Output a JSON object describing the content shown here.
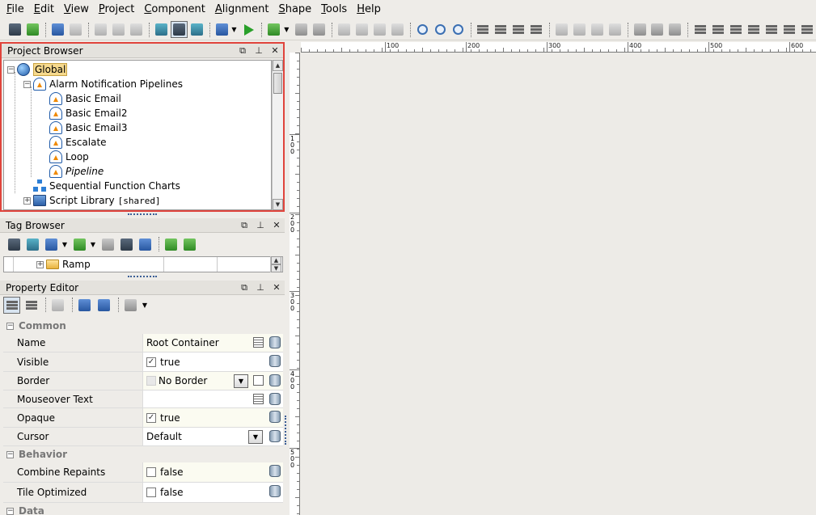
{
  "menu": [
    {
      "label": "File",
      "u": "F",
      "rest": "ile"
    },
    {
      "label": "Edit",
      "u": "E",
      "rest": "dit"
    },
    {
      "label": "View",
      "u": "V",
      "rest": "iew"
    },
    {
      "label": "Project",
      "u": "P",
      "rest": "roject"
    },
    {
      "label": "Component",
      "u": "C",
      "rest": "omponent"
    },
    {
      "label": "Alignment",
      "u": "A",
      "rest": "lignment"
    },
    {
      "label": "Shape",
      "u": "S",
      "rest": "hape"
    },
    {
      "label": "Tools",
      "u": "T",
      "rest": "ools"
    },
    {
      "label": "Help",
      "u": "H",
      "rest": "elp"
    }
  ],
  "project_browser": {
    "title": "Project Browser",
    "tree": [
      {
        "label": "Global",
        "icon": "globe-icon",
        "level": 0,
        "expander": "−",
        "selected": true
      },
      {
        "label": "Alarm Notification Pipelines",
        "icon": "alarm-pipeline-icon",
        "level": 1,
        "expander": "−"
      },
      {
        "label": "Basic Email",
        "icon": "alarm-pipeline-icon",
        "level": 2
      },
      {
        "label": "Basic Email2",
        "icon": "alarm-pipeline-icon",
        "level": 2
      },
      {
        "label": "Basic Email3",
        "icon": "alarm-pipeline-icon",
        "level": 2
      },
      {
        "label": "Escalate",
        "icon": "alarm-pipeline-icon",
        "level": 2
      },
      {
        "label": "Loop",
        "icon": "alarm-pipeline-icon",
        "level": 2
      },
      {
        "label": "Pipeline",
        "icon": "alarm-pipeline-icon",
        "level": 2,
        "italic": true
      },
      {
        "label": "Sequential Function Charts",
        "icon": "sfc-icon",
        "level": 1
      },
      {
        "label": "Script Library",
        "suffix": "[shared]",
        "icon": "script-library-icon",
        "level": 1,
        "expander": "+"
      }
    ]
  },
  "tag_browser": {
    "title": "Tag Browser",
    "row": {
      "label": "Ramp",
      "icon": "folder-icon",
      "expander": "+"
    }
  },
  "property_editor": {
    "title": "Property Editor",
    "categories": [
      {
        "name": "Common",
        "props": [
          {
            "name": "Name",
            "value": "Root Container",
            "editor": "edit"
          },
          {
            "name": "Visible",
            "value": "true",
            "checkbox": true,
            "checked": true
          },
          {
            "name": "Border",
            "value": "No Border",
            "combo": true,
            "swatch": true,
            "extra": "border-edit"
          },
          {
            "name": "Mouseover Text",
            "value": "",
            "editor": "edit"
          },
          {
            "name": "Opaque",
            "value": "true",
            "checkbox": true,
            "checked": true
          },
          {
            "name": "Cursor",
            "value": "Default",
            "combo": true
          }
        ]
      },
      {
        "name": "Behavior",
        "props": [
          {
            "name": "Combine Repaints",
            "value": "false",
            "checkbox": true,
            "checked": false
          },
          {
            "name": "Tile Optimized",
            "value": "false",
            "checkbox": true,
            "checked": false
          }
        ]
      },
      {
        "name": "Data",
        "props": []
      }
    ]
  },
  "ruler": {
    "top_labels": [
      "100",
      "200",
      "300",
      "400",
      "500",
      "600"
    ],
    "left_labels": [
      "100",
      "200",
      "300",
      "400",
      "500"
    ]
  },
  "colors": {
    "selection_outline": "#e0443c",
    "selected_node": "#f6d98d",
    "splitter_dots": "#3b5e96"
  }
}
